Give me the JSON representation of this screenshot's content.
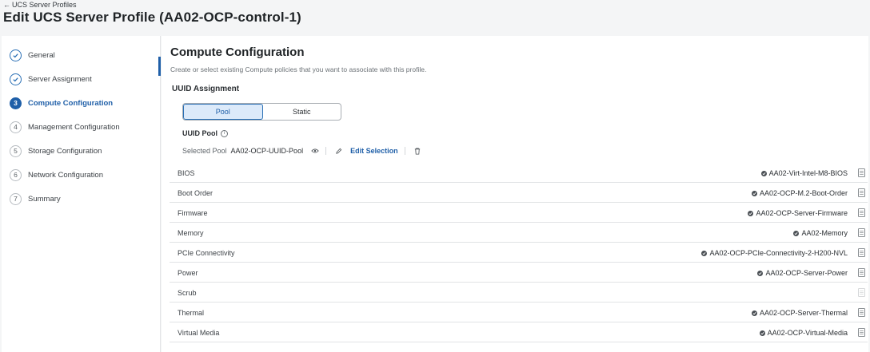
{
  "breadcrumb": {
    "label": "UCS Server Profiles"
  },
  "page": {
    "title": "Edit UCS Server Profile (AA02-OCP-control-1)"
  },
  "steps": [
    {
      "num": "1",
      "label": "General",
      "state": "done"
    },
    {
      "num": "2",
      "label": "Server Assignment",
      "state": "done"
    },
    {
      "num": "3",
      "label": "Compute Configuration",
      "state": "active"
    },
    {
      "num": "4",
      "label": "Management Configuration",
      "state": "todo"
    },
    {
      "num": "5",
      "label": "Storage Configuration",
      "state": "todo"
    },
    {
      "num": "6",
      "label": "Network Configuration",
      "state": "todo"
    },
    {
      "num": "7",
      "label": "Summary",
      "state": "todo"
    }
  ],
  "main": {
    "title": "Compute Configuration",
    "subtitle": "Create or select existing Compute policies that you want to associate with this profile.",
    "uuid": {
      "title": "UUID Assignment",
      "options": [
        "Pool",
        "Static"
      ],
      "selected": "Pool",
      "pool_label": "UUID Pool",
      "selected_pool_label": "Selected Pool",
      "selected_pool_value": "AA02-OCP-UUID-Pool",
      "edit_selection": "Edit Selection"
    },
    "policies": [
      {
        "name": "BIOS",
        "value": "AA02-Virt-Intel-M8-BIOS"
      },
      {
        "name": "Boot Order",
        "value": "AA02-OCP-M.2-Boot-Order"
      },
      {
        "name": "Firmware",
        "value": "AA02-OCP-Server-Firmware"
      },
      {
        "name": "Memory",
        "value": "AA02-Memory"
      },
      {
        "name": "PCIe Connectivity",
        "value": "AA02-OCP-PCIe-Connectivity-2-H200-NVL"
      },
      {
        "name": "Power",
        "value": "AA02-OCP-Server-Power"
      },
      {
        "name": "Scrub",
        "value": ""
      },
      {
        "name": "Thermal",
        "value": "AA02-OCP-Server-Thermal"
      },
      {
        "name": "Virtual Media",
        "value": "AA02-OCP-Virtual-Media"
      }
    ]
  },
  "colors": {
    "accent": "#1f5fa8",
    "selected_bg": "#dceafa"
  },
  "icons": {
    "back": "arrow-left-icon",
    "done": "check-circle-icon",
    "info": "info-icon",
    "view": "eye-icon",
    "edit": "pencil-icon",
    "delete": "trash-icon",
    "assigned": "check-badge-icon",
    "detail": "document-icon"
  }
}
